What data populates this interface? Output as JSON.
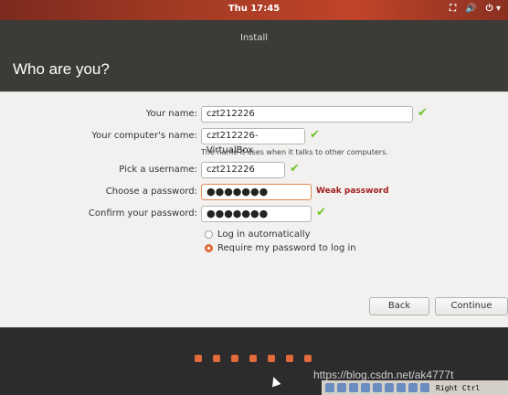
{
  "topbar": {
    "clock": "Thu 17:45",
    "icons": [
      "network-icon",
      "volume-icon",
      "power-icon"
    ]
  },
  "window": {
    "title": "Install"
  },
  "page": {
    "title": "Who are you?"
  },
  "form": {
    "name_label": "Your name:",
    "name_value": "czt212226",
    "computer_label": "Your computer's name:",
    "computer_value": "czt212226-VirtualBox",
    "computer_hint": "The name it uses when it talks to other computers.",
    "username_label": "Pick a username:",
    "username_value": "czt212226",
    "password_label": "Choose a password:",
    "password_value": "●●●●●●●",
    "password_strength": "Weak password",
    "confirm_label": "Confirm your password:",
    "confirm_value": "●●●●●●●",
    "check_glyph": "✔",
    "login_auto": "Log in automatically",
    "login_require": "Require my password to log in",
    "selected_login": "require"
  },
  "buttons": {
    "back": "Back",
    "continue": "Continue"
  },
  "slideshow": {
    "dots": 7
  },
  "watermark": "https://blog.csdn.net/ak4777t",
  "vbox": {
    "host_key": "Right Ctrl"
  },
  "colors": {
    "accent": "#e26a3b",
    "check": "#73c22b",
    "error": "#a11e1e",
    "header": "#3c3b37"
  }
}
